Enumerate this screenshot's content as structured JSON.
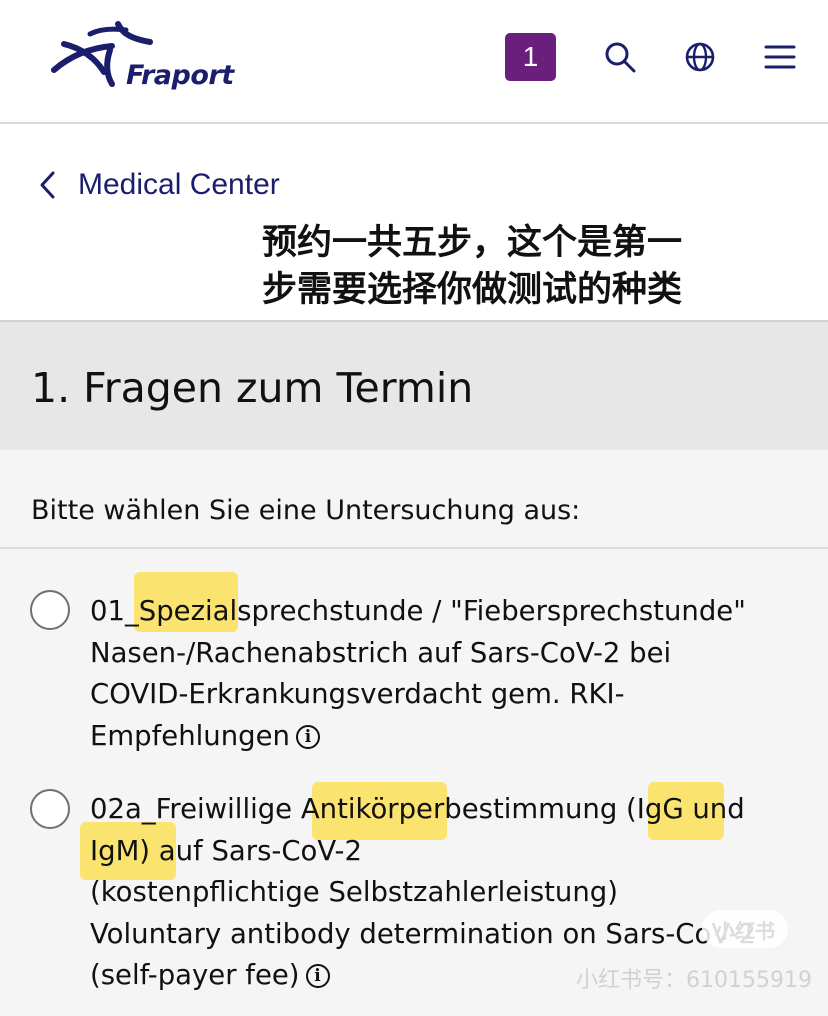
{
  "header": {
    "logo_text": "Fraport",
    "badge_count": "1",
    "icons": [
      "search-icon",
      "globe-icon",
      "menu-icon"
    ]
  },
  "nav": {
    "back_label": "Medical Center"
  },
  "annotation": {
    "line1": "预约一共五步，这个是第一",
    "line2": "步需要选择你做测试的种类"
  },
  "section": {
    "title": "1. Fragen zum Termin"
  },
  "question": "Bitte wählen Sie eine Untersuchung aus:",
  "options": [
    {
      "lines": [
        "01_Spezialsprechstunde / \"Fiebersprechstunde\"",
        "Nasen-/Rachenabstrich auf Sars-CoV-2 bei",
        "COVID-Erkrankungsverdacht gem. RKI-",
        "Empfehlungen"
      ],
      "selected": false
    },
    {
      "lines": [
        "02a_Freiwillige Antikörperbestimmung (IgG und",
        "IgM) auf Sars-CoV-2",
        "(kostenpflichtige Selbstzahlerleistung)",
        "Voluntary antibody determination on Sars-CoV-2",
        "(self-payer fee)"
      ],
      "selected": false
    }
  ],
  "watermark": {
    "brand": "小红书",
    "id": "小红书号：610155919"
  },
  "colors": {
    "brand_navy": "#1b1e6b",
    "badge_purple": "#6a1f7d",
    "highlight": "#ffd400"
  }
}
